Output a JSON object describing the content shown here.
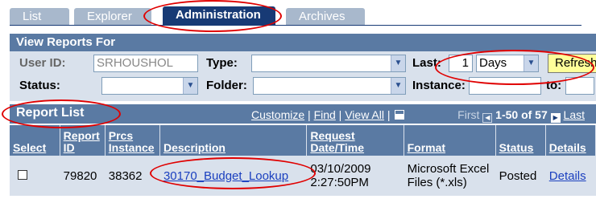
{
  "tabs": [
    {
      "label": "List",
      "active": false
    },
    {
      "label": "Explorer",
      "active": false
    },
    {
      "label": "Administration",
      "active": true
    },
    {
      "label": "Archives",
      "active": false
    }
  ],
  "criteria": {
    "title": "View Reports For",
    "user_id_label": "User ID:",
    "user_id_value": "SRHOUSHOL",
    "type_label": "Type:",
    "type_value": "",
    "last_label": "Last:",
    "last_value": "1",
    "last_unit": "Days",
    "refresh_label": "Refresh",
    "status_label": "Status:",
    "status_value": "",
    "folder_label": "Folder:",
    "folder_value": "",
    "instance_label": "Instance:",
    "instance_from": "",
    "to_label": "to:",
    "instance_to": ""
  },
  "report_list": {
    "title": "Report List",
    "customize": "Customize",
    "find": "Find",
    "view_all": "View All",
    "first": "First",
    "range": "1-50 of 57",
    "last": "Last",
    "columns": [
      "Select",
      "Report ID",
      "Prcs Instance",
      "Description",
      "Request Date/Time",
      "Format",
      "Status",
      "Details"
    ],
    "rows": [
      {
        "report_id": "79820",
        "prcs_instance": "38362",
        "description": "30170_Budget_Lookup",
        "request_date": "03/10/2009",
        "request_time": "2:27:50PM",
        "format": "Microsoft Excel Files (*.xls)",
        "status": "Posted",
        "details": "Details"
      }
    ]
  },
  "colors": {
    "header_blue": "#5a7aa3",
    "panel_bg": "#d9e1ec",
    "active_tab": "#173a75",
    "refresh_bg": "#ffff99",
    "annotation": "#e00000"
  }
}
